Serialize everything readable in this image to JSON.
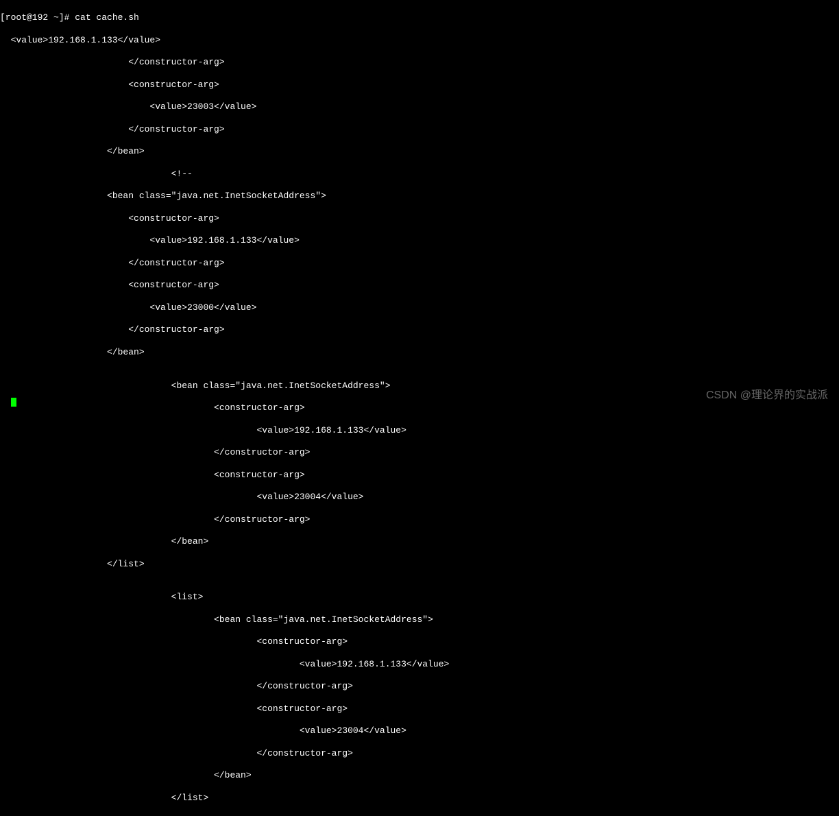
{
  "prompt": "[root@192 ~]# cat cache.sh",
  "lines": [
    "  <value>192.168.1.133</value>",
    "                        </constructor-arg>",
    "                        <constructor-arg>",
    "                            <value>23003</value>",
    "                        </constructor-arg>",
    "                    </bean>",
    "                                <!--",
    "                    <bean class=\"java.net.InetSocketAddress\">",
    "                        <constructor-arg>",
    "                            <value>192.168.1.133</value>",
    "                        </constructor-arg>",
    "                        <constructor-arg>",
    "                            <value>23000</value>",
    "                        </constructor-arg>",
    "                    </bean>",
    "",
    "                                <bean class=\"java.net.InetSocketAddress\">",
    "                                        <constructor-arg>",
    "                                                <value>192.168.1.133</value>",
    "                                        </constructor-arg>",
    "                                        <constructor-arg>",
    "                                                <value>23004</value>",
    "                                        </constructor-arg>",
    "                                </bean>",
    "                    </list>",
    "",
    "                                <list>",
    "                                        <bean class=\"java.net.InetSocketAddress\">",
    "                                                <constructor-arg>",
    "                                                        <value>192.168.1.133</value>",
    "                                                </constructor-arg>",
    "                                                <constructor-arg>",
    "                                                        <value>23004</value>",
    "                                                </constructor-arg>",
    "                                        </bean>",
    "                                </list>"
  ],
  "watermark": "CSDN @理论界的实战派"
}
